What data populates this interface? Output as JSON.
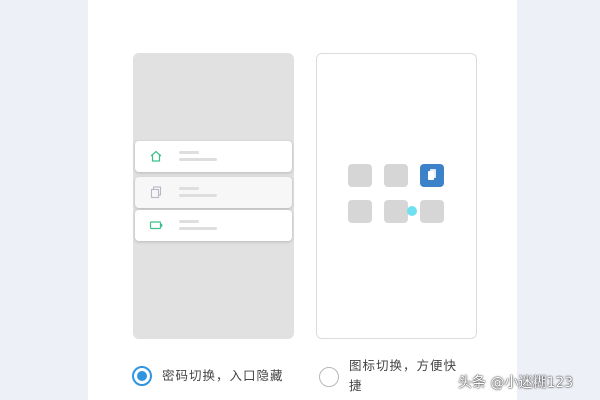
{
  "options": [
    {
      "label": "密码切换，入口隐藏",
      "selected": true,
      "icons": [
        "home-icon",
        "copy-icon",
        "battery-icon"
      ]
    },
    {
      "label_line1": "图标切换，方便快",
      "label_line2": "捷",
      "selected": false
    }
  ],
  "colors": {
    "accent": "#2f95e0",
    "active_tile": "#3b82c8",
    "cursor_dot": "#6fe0f0",
    "icon_green": "#3cbf8a"
  },
  "watermark": "头条 @小迷糊123"
}
